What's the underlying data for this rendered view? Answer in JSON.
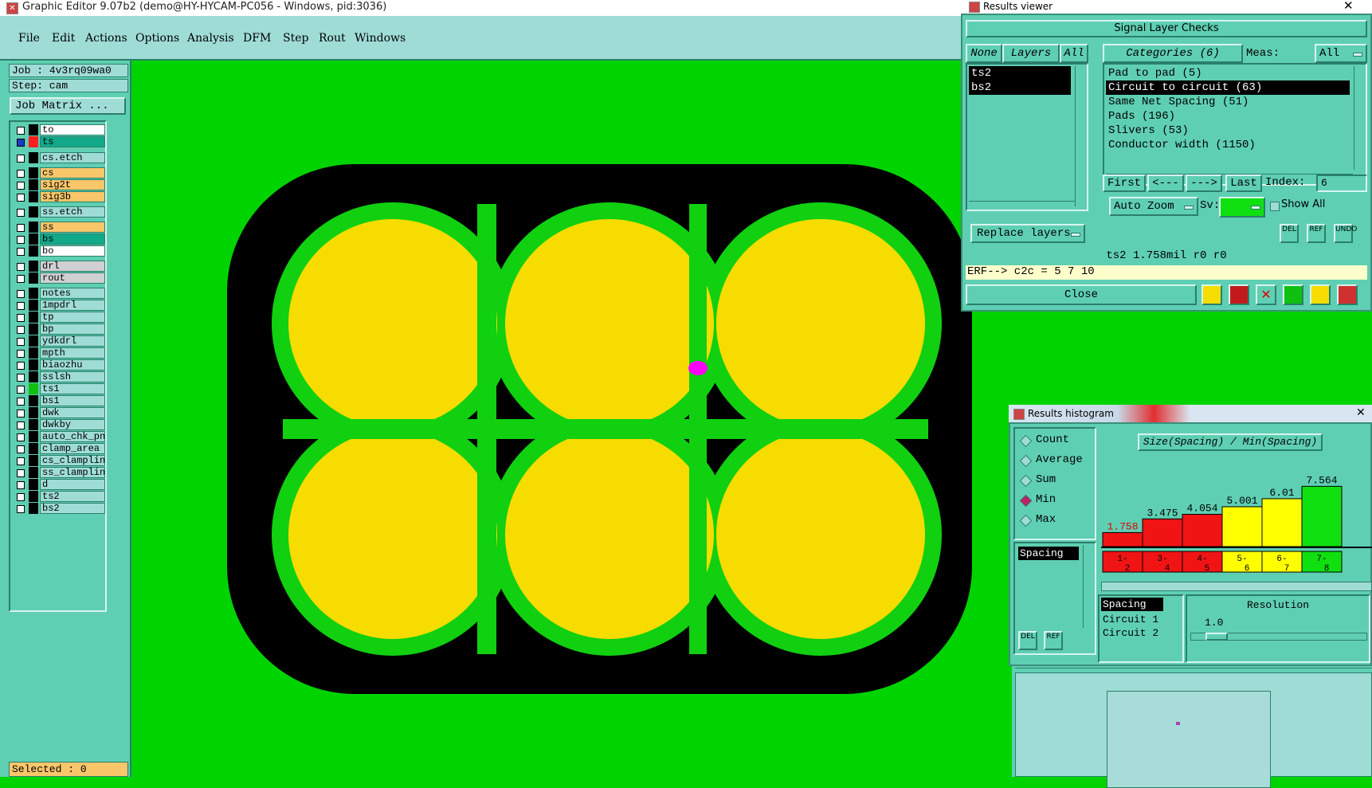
{
  "main_window": {
    "title": "Graphic Editor 9.07b2 (demo@HY-HYCAM-PC056 - Windows, pid:3036)",
    "menu": [
      "File",
      "Edit",
      "Actions",
      "Options",
      "Analysis",
      "DFM",
      "Step",
      "Rout",
      "Windows"
    ]
  },
  "left_panel": {
    "job": "Job : 4v3rq09wa0",
    "step": "Step: cam",
    "job_matrix_label": "Job Matrix ...",
    "selected": "Selected : 0",
    "layers": [
      {
        "name": "to",
        "color": "#ffffff",
        "swatch": "#000000",
        "checked": false
      },
      {
        "name": "ts",
        "color": "#11a98a",
        "swatch": "#ff1e1e",
        "checked": true
      },
      {
        "name": "cs.etch",
        "color": "#9fdcd6",
        "swatch": "#000000",
        "checked": false
      },
      {
        "name": "cs",
        "color": "#f9c66a",
        "swatch": "#000000",
        "checked": false
      },
      {
        "name": "sig2t",
        "color": "#f9c66a",
        "swatch": "#000000",
        "checked": false
      },
      {
        "name": "sig3b",
        "color": "#f9c66a",
        "swatch": "#000000",
        "checked": false
      },
      {
        "name": "ss.etch",
        "color": "#9fdcd6",
        "swatch": "#000000",
        "checked": false
      },
      {
        "name": "ss",
        "color": "#f9c66a",
        "swatch": "#000000",
        "checked": false
      },
      {
        "name": "bs",
        "color": "#11a98a",
        "swatch": "#000000",
        "checked": false
      },
      {
        "name": "bo",
        "color": "#ffffff",
        "swatch": "#000000",
        "checked": false
      },
      {
        "name": "drl",
        "color": "#d0d0d0",
        "swatch": "#000000",
        "checked": false
      },
      {
        "name": "rout",
        "color": "#d0d0d0",
        "swatch": "#000000",
        "checked": false
      },
      {
        "name": "notes",
        "color": "#9fdcd6",
        "swatch": "#000000",
        "checked": false
      },
      {
        "name": "1mpdrl",
        "color": "#9fdcd6",
        "swatch": "#000000",
        "checked": false
      },
      {
        "name": "tp",
        "color": "#9fdcd6",
        "swatch": "#000000",
        "checked": false
      },
      {
        "name": "bp",
        "color": "#9fdcd6",
        "swatch": "#000000",
        "checked": false
      },
      {
        "name": "ydkdrl",
        "color": "#9fdcd6",
        "swatch": "#000000",
        "checked": false
      },
      {
        "name": "mpth",
        "color": "#9fdcd6",
        "swatch": "#000000",
        "checked": false
      },
      {
        "name": "biaozhu",
        "color": "#9fdcd6",
        "swatch": "#000000",
        "checked": false
      },
      {
        "name": "sslsh",
        "color": "#9fdcd6",
        "swatch": "#000000",
        "checked": false
      },
      {
        "name": "ts1",
        "color": "#9fdcd6",
        "swatch": "#10c010",
        "checked": false
      },
      {
        "name": "bs1",
        "color": "#9fdcd6",
        "swatch": "#000000",
        "checked": false
      },
      {
        "name": "dwk",
        "color": "#9fdcd6",
        "swatch": "#000000",
        "checked": false
      },
      {
        "name": "dwkby",
        "color": "#9fdcd6",
        "swatch": "#000000",
        "checked": false
      },
      {
        "name": "auto_chk_pnl",
        "color": "#9fdcd6",
        "swatch": "#000000",
        "checked": false
      },
      {
        "name": "clamp_area",
        "color": "#9fdcd6",
        "swatch": "#000000",
        "checked": false
      },
      {
        "name": "cs_clampline",
        "color": "#9fdcd6",
        "swatch": "#000000",
        "checked": false
      },
      {
        "name": "ss_clampline",
        "color": "#9fdcd6",
        "swatch": "#000000",
        "checked": false
      },
      {
        "name": "d",
        "color": "#9fdcd6",
        "swatch": "#000000",
        "checked": false
      },
      {
        "name": "ts2",
        "color": "#9fdcd6",
        "swatch": "#000000",
        "checked": false
      },
      {
        "name": "bs2",
        "color": "#9fdcd6",
        "swatch": "#000000",
        "checked": false
      }
    ]
  },
  "canvas": {
    "background": "#00d400",
    "outline_color": "#000000",
    "pad_ring_color": "#10d010",
    "pad_fill_color": "#f7dc00",
    "marker_color": "#ff00ff"
  },
  "results_viewer": {
    "title": "Results viewer",
    "header": "Signal Layer Checks",
    "none_btn": "None",
    "layers_btn": "Layers",
    "all_btn": "All",
    "categories_btn": "Categories (6)",
    "meas_label": "Meas:",
    "meas_value": "All",
    "layer_items": [
      "ts2",
      "bs2"
    ],
    "categories": [
      "Pad to pad (5)",
      "Circuit to circuit (63)",
      "Same Net Spacing (51)",
      "Pads (196)",
      "Slivers (53)",
      "Conductor width (1150)"
    ],
    "selected_category_index": 1,
    "first_btn": "First",
    "prev_btn": "<---",
    "next_btn": "--->",
    "last_btn": "Last",
    "index_label": "Index:",
    "index_value": "6",
    "auto_zoom_btn": "Auto Zoom",
    "sv_label": "Sv:",
    "show_all_label": "Show All",
    "replace_layers_btn": "Replace layers",
    "del_label": "DEL",
    "ref_label": "REF",
    "undo_label": "UNDO",
    "status_line": "ts2  1.758mil   r0   r0",
    "erf_line": "ERF--> c2c = 5 7 10",
    "close_btn": "Close"
  },
  "histogram": {
    "title": "Results histogram",
    "modes": [
      {
        "label": "Count",
        "selected": false
      },
      {
        "label": "Average",
        "selected": false
      },
      {
        "label": "Sum",
        "selected": false
      },
      {
        "label": "Min",
        "selected": true
      },
      {
        "label": "Max",
        "selected": false
      }
    ],
    "list_items": [
      "Spacing"
    ],
    "chart_title": "Size(Spacing) / Min(Spacing)",
    "del_label": "DEL",
    "ref_label": "REF",
    "info_items": [
      "Spacing",
      "Circuit 1",
      "Circuit 2"
    ],
    "resolution_label": "Resolution",
    "resolution_value": "1.0"
  },
  "chart_data": {
    "type": "bar",
    "title": "Size(Spacing) / Min(Spacing)",
    "categories": [
      "1-2",
      "3-4",
      "4-5",
      "5-6",
      "6-7",
      "7-8"
    ],
    "values": [
      1.758,
      3.475,
      4.054,
      5.001,
      6.01,
      7.564
    ],
    "value_labels": [
      "1.758",
      "3.475",
      "4.054",
      "5.001",
      "6.01",
      "7.564"
    ],
    "bar_colors": [
      "#f01414",
      "#f01414",
      "#f01414",
      "#ffff00",
      "#ffff00",
      "#10e010"
    ],
    "label_colors": [
      "#e00000",
      "#000000",
      "#000000",
      "#000000",
      "#000000",
      "#000000"
    ],
    "ylim": [
      0,
      8
    ]
  }
}
